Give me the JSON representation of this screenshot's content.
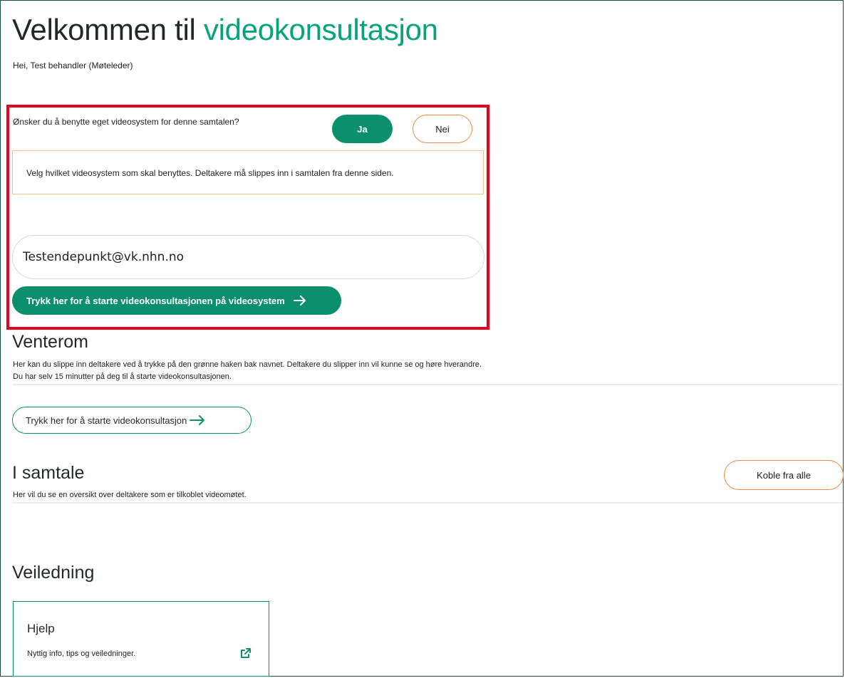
{
  "header": {
    "title_main": "Velkommen til",
    "title_accent": "videokonsultasjon",
    "greeting": "Hei, Test behandler (Møteleder)"
  },
  "own_system": {
    "question": "Ønsker du å benytte eget videosystem for denne samtalen?",
    "yes_label": "Ja",
    "no_label": "Nei",
    "info": "Velg hvilket videosystem som skal benyttes. Deltakere må slippes inn i samtalen fra denne siden.",
    "endpoint_value": "Testendepunkt@vk.nhn.no",
    "start_button": "Trykk her for å starte videokonsultasjonen på videosystem"
  },
  "venterom": {
    "title": "Venterom",
    "desc_line1": "Her kan du slippe inn deltakere ved å trykke på den grønne haken bak navnet. Deltakere du slipper inn vil kunne se og høre hverandre.",
    "desc_line2": "Du har selv 15 minutter på deg til å starte videokonsultasjonen.",
    "start_button": "Trykk her for å starte videokonsultasjon"
  },
  "i_samtale": {
    "title": "I samtale",
    "desc": "Her vil du se en oversikt over deltakere som er tilkoblet videomøtet.",
    "disconnect_button": "Koble fra alle"
  },
  "veiledning": {
    "title": "Veiledning",
    "card_title": "Hjelp",
    "card_desc": "Nyttig info, tips og veiledninger."
  },
  "colors": {
    "brand_green": "#0c8f6d",
    "accent_green": "#07a37c",
    "orange_outline": "#f08a4b",
    "highlight_red": "#e8001c"
  },
  "icons": {
    "arrow": "arrow-right-icon",
    "external": "external-link-icon"
  }
}
